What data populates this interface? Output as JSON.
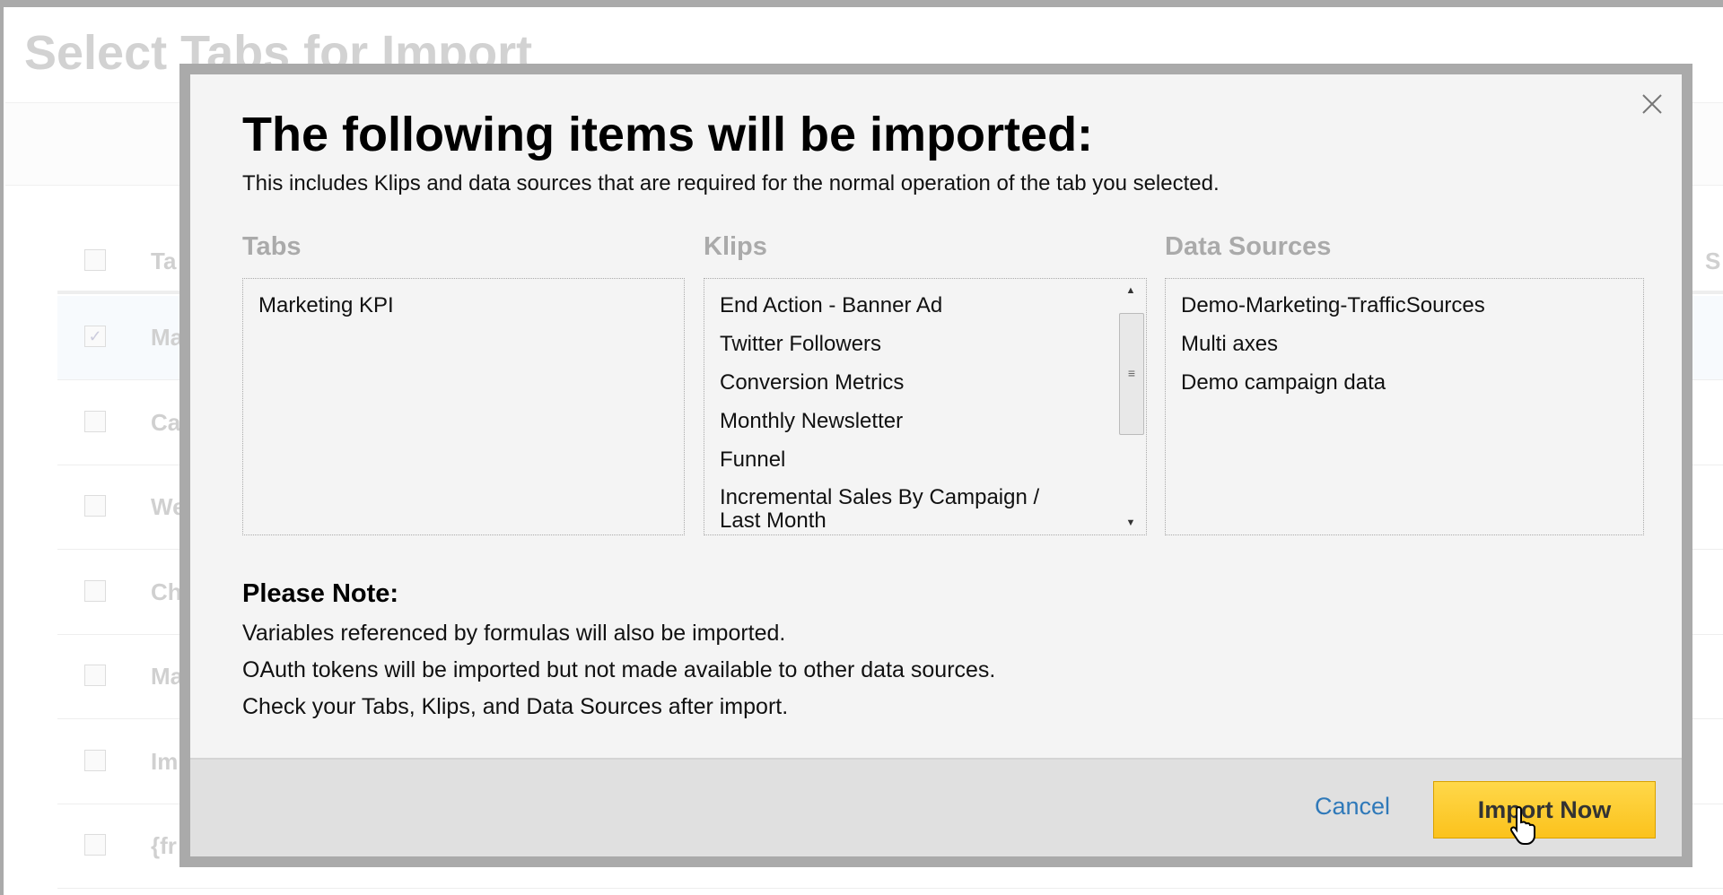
{
  "background": {
    "page_title": "Select Tabs for Import",
    "column_header_partial": "Ta",
    "right_header_partial": "S",
    "rows": [
      {
        "text": "Ma",
        "checked": true
      },
      {
        "text": "Ca",
        "checked": false
      },
      {
        "text": "We",
        "checked": false
      },
      {
        "text": "Ch",
        "checked": false
      },
      {
        "text": "Ma",
        "checked": false
      },
      {
        "text": "Im",
        "checked": false
      },
      {
        "text": "{fr",
        "checked": false
      }
    ]
  },
  "dialog": {
    "heading": "The following items will be imported:",
    "subtitle": "This includes Klips and data sources that are required for the normal operation of the tab you selected.",
    "columns": {
      "tabs": {
        "title": "Tabs",
        "items": [
          "Marketing KPI"
        ]
      },
      "klips": {
        "title": "Klips",
        "items": [
          "End Action - Banner Ad",
          "Twitter Followers",
          "Conversion Metrics",
          "Monthly Newsletter",
          "Funnel",
          "Incremental Sales By Campaign / Last Month"
        ]
      },
      "data_sources": {
        "title": "Data Sources",
        "items": [
          "Demo-Marketing-TrafficSources",
          "Multi axes",
          "Demo campaign data"
        ]
      }
    },
    "note": {
      "title": "Please Note:",
      "lines": [
        "Variables referenced by formulas will also be imported.",
        "OAuth tokens will be imported but not made available to other data sources.",
        "Check your Tabs, Klips, and Data Sources after import."
      ]
    },
    "cancel_label": "Cancel",
    "import_label": "Import Now",
    "close_icon": "close-icon"
  },
  "colors": {
    "accent_button": "#fbc21c",
    "link": "#2f79b9",
    "modal_border": "#aaaaaa"
  }
}
